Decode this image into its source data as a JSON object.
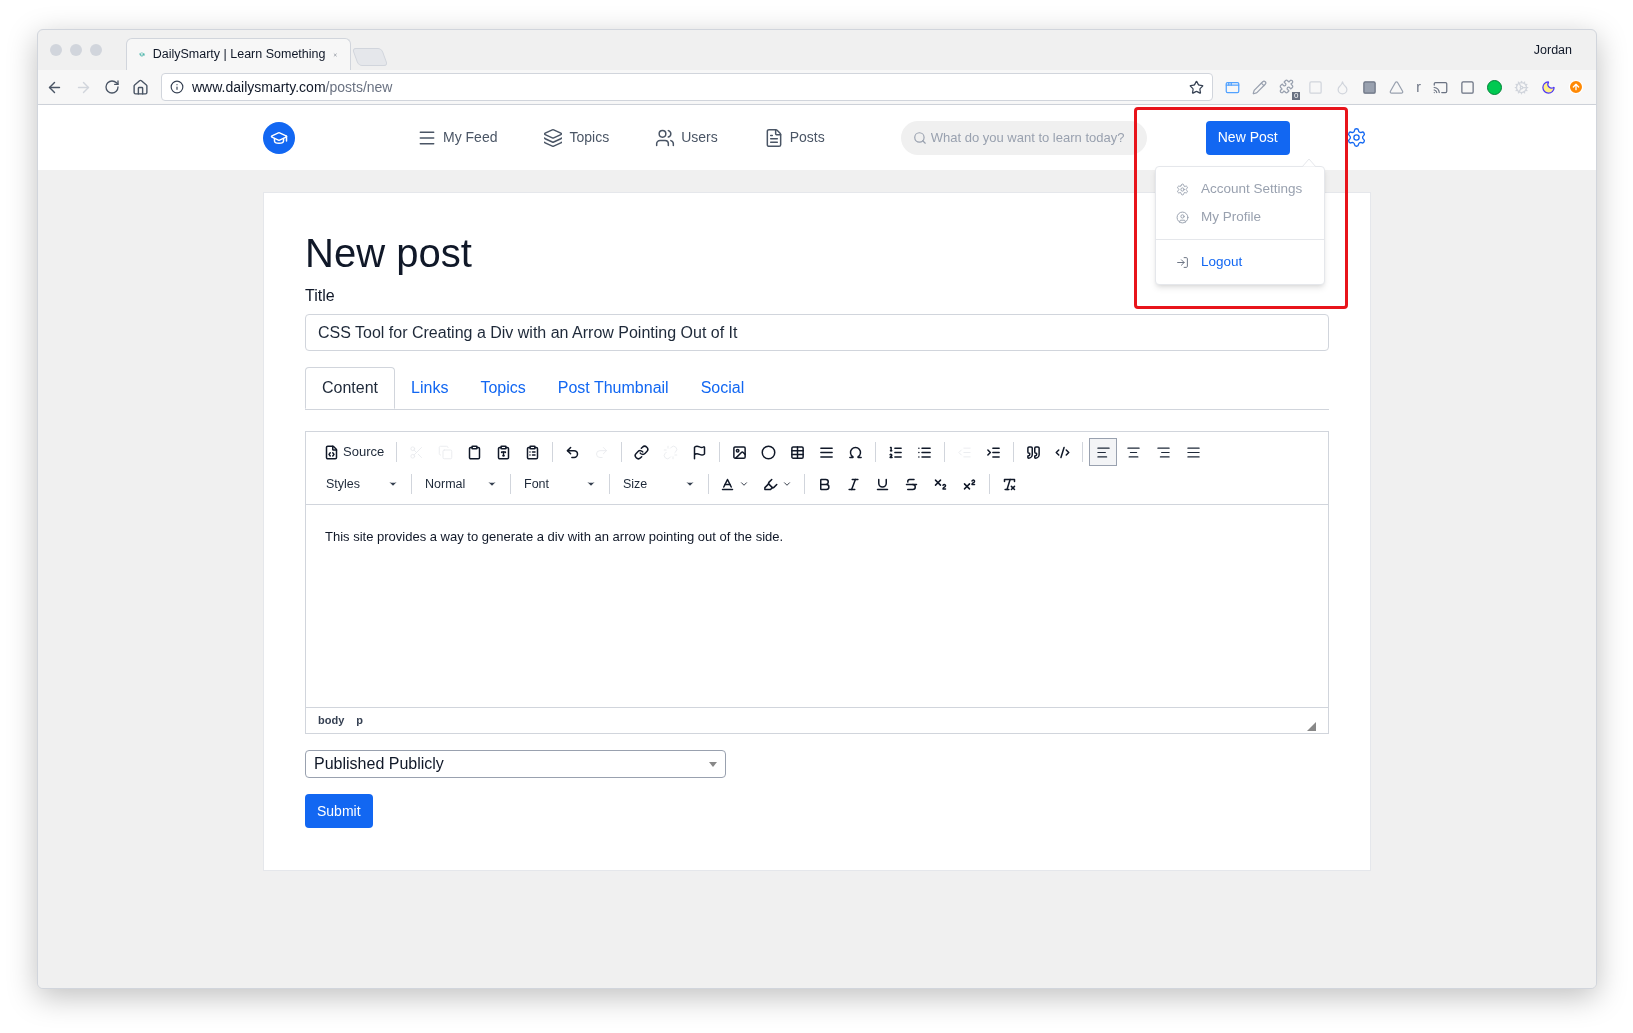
{
  "browser": {
    "tab_title": "DailySmarty | Learn Something",
    "profile": "Jordan",
    "url_host": "www.dailysmarty.com",
    "url_path": "/posts/new",
    "extension_badge": "0",
    "extension_letter": "r"
  },
  "nav": {
    "items": [
      {
        "kind": "feed",
        "label": "My Feed"
      },
      {
        "kind": "topics",
        "label": "Topics"
      },
      {
        "kind": "users",
        "label": "Users"
      },
      {
        "kind": "posts",
        "label": "Posts"
      }
    ],
    "search": {
      "placeholder": "What do you want to learn today?"
    },
    "new_post": "New Post"
  },
  "account_menu": {
    "expanded": true,
    "items": [
      {
        "kind": "settings",
        "label": "Account Settings",
        "disabled": true
      },
      {
        "kind": "profile",
        "label": "My Profile",
        "disabled": true
      },
      {
        "kind": "logout",
        "label": "Logout",
        "disabled": false
      }
    ]
  },
  "highlight": true,
  "page": {
    "heading": "New post",
    "title_label": "Title",
    "title_value": "CSS Tool for Creating a Div with an Arrow Pointing Out of It"
  },
  "tabs": [
    {
      "label": "Content",
      "selected": true
    },
    {
      "label": "Links",
      "selected": false
    },
    {
      "label": "Topics",
      "selected": false
    },
    {
      "label": "Post Thumbnail",
      "selected": false
    },
    {
      "label": "Social",
      "selected": false
    }
  ],
  "editor": {
    "toolbar_1": [
      {
        "kind": "source",
        "label": "Source",
        "disabled": false
      },
      {
        "kind": "separator"
      },
      {
        "kind": "cut",
        "disabled": true
      },
      {
        "kind": "copy",
        "disabled": true
      },
      {
        "kind": "paste",
        "disabled": false
      },
      {
        "kind": "paste-text",
        "disabled": false
      },
      {
        "kind": "paste-word",
        "disabled": false
      },
      {
        "kind": "separator"
      },
      {
        "kind": "undo",
        "disabled": false
      },
      {
        "kind": "redo",
        "disabled": true
      },
      {
        "kind": "separator"
      },
      {
        "kind": "link",
        "disabled": false
      },
      {
        "kind": "unlink",
        "disabled": true
      },
      {
        "kind": "anchor",
        "disabled": false
      },
      {
        "kind": "separator"
      },
      {
        "kind": "image",
        "disabled": false
      },
      {
        "kind": "flash",
        "disabled": false
      },
      {
        "kind": "table",
        "disabled": false
      },
      {
        "kind": "rule",
        "disabled": false
      },
      {
        "kind": "special-char",
        "disabled": false
      },
      {
        "kind": "separator"
      },
      {
        "kind": "numbered-list",
        "disabled": false
      },
      {
        "kind": "bulleted-list",
        "disabled": false
      },
      {
        "kind": "separator"
      },
      {
        "kind": "outdent",
        "disabled": true
      },
      {
        "kind": "indent",
        "disabled": false
      },
      {
        "kind": "separator"
      },
      {
        "kind": "blockquote",
        "disabled": false
      },
      {
        "kind": "div",
        "disabled": false
      },
      {
        "kind": "separator"
      }
    ],
    "alignment": [
      {
        "kind": "left",
        "selected": true
      },
      {
        "kind": "center",
        "selected": false
      },
      {
        "kind": "right",
        "selected": false
      },
      {
        "kind": "justify",
        "selected": false
      }
    ],
    "combos": [
      "Styles",
      "Normal",
      "Font",
      "Size"
    ],
    "toolbar_2": [
      {
        "kind": "text-color",
        "disabled": false
      },
      {
        "kind": "background-color",
        "disabled": false
      },
      {
        "kind": "separator"
      },
      {
        "kind": "bold",
        "disabled": false
      },
      {
        "kind": "italic",
        "disabled": false
      },
      {
        "kind": "underline",
        "disabled": false
      },
      {
        "kind": "strike",
        "disabled": false
      },
      {
        "kind": "subscript",
        "disabled": false
      },
      {
        "kind": "superscript",
        "disabled": false
      },
      {
        "kind": "separator"
      },
      {
        "kind": "remove-format",
        "disabled": false
      }
    ],
    "body": "This site provides a way to generate a div with an arrow pointing out of the side.",
    "path": [
      "body",
      "p"
    ]
  },
  "visibility": {
    "value": "Published Publicly"
  },
  "submit": "Submit"
}
